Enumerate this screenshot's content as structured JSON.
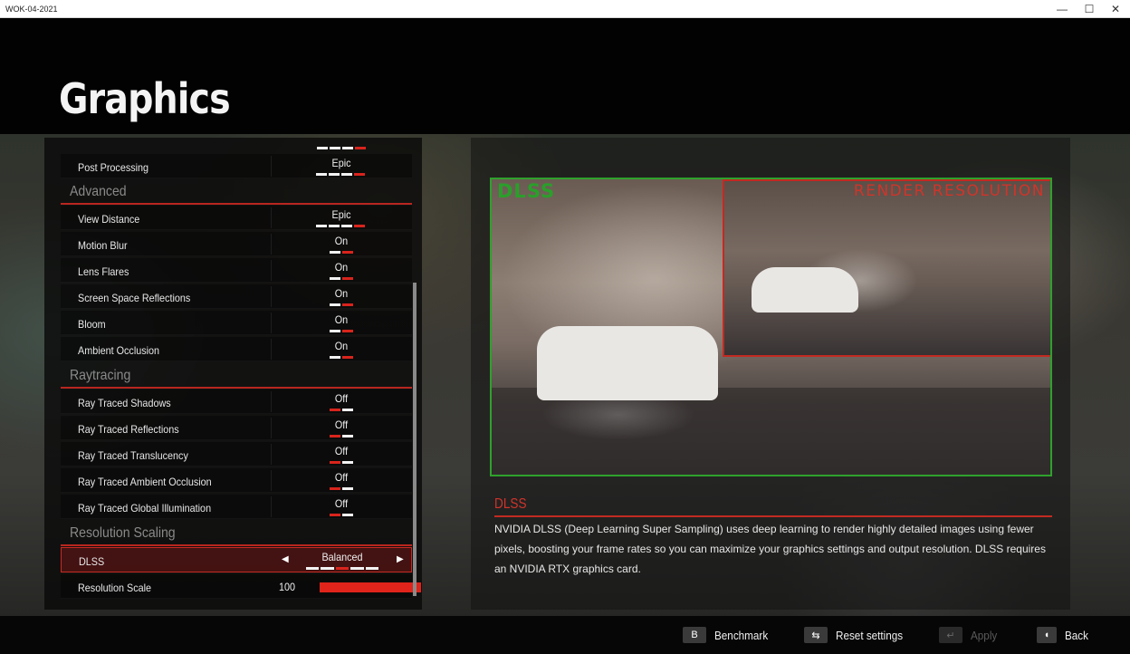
{
  "window": {
    "title": "WOK-04-2021",
    "minimize": "—",
    "maximize": "☐",
    "close": "✕"
  },
  "page": {
    "title": "Graphics"
  },
  "settings": {
    "rows": [
      {
        "label": "Post Processing",
        "value": "Epic",
        "pips": [
          "w",
          "w",
          "w",
          "r"
        ]
      },
      {
        "label": "View Distance",
        "value": "Epic",
        "pips": [
          "w",
          "w",
          "w",
          "r"
        ]
      },
      {
        "label": "Motion Blur",
        "value": "On",
        "pips": [
          "w",
          "r"
        ]
      },
      {
        "label": "Lens Flares",
        "value": "On",
        "pips": [
          "w",
          "r"
        ]
      },
      {
        "label": "Screen Space Reflections",
        "value": "On",
        "pips": [
          "w",
          "r"
        ]
      },
      {
        "label": "Bloom",
        "value": "On",
        "pips": [
          "w",
          "r"
        ]
      },
      {
        "label": "Ambient Occlusion",
        "value": "On",
        "pips": [
          "w",
          "r"
        ]
      },
      {
        "label": "Ray Traced Shadows",
        "value": "Off",
        "pips": [
          "r",
          "w"
        ]
      },
      {
        "label": "Ray Traced Reflections",
        "value": "Off",
        "pips": [
          "r",
          "w"
        ]
      },
      {
        "label": "Ray Traced Translucency",
        "value": "Off",
        "pips": [
          "r",
          "w"
        ]
      },
      {
        "label": "Ray Traced Ambient Occlusion",
        "value": "Off",
        "pips": [
          "r",
          "w"
        ]
      },
      {
        "label": "Ray Traced Global Illumination",
        "value": "Off",
        "pips": [
          "r",
          "w"
        ]
      }
    ],
    "sections": {
      "advanced": "Advanced",
      "raytracing": "Raytracing",
      "resolution_scaling": "Resolution Scaling"
    },
    "dlss": {
      "label": "DLSS",
      "value": "Balanced",
      "left_arrow": "◀",
      "right_arrow": "▶",
      "pips": [
        "w",
        "w",
        "r",
        "w",
        "w"
      ]
    },
    "resolution_scale": {
      "label": "Resolution Scale",
      "value": "100",
      "fraction": 1.0
    }
  },
  "preview": {
    "dlss_tag": "DLSS",
    "render_tag": "RENDER RESOLUTION",
    "title": "DLSS",
    "description": "NVIDIA DLSS (Deep Learning Super Sampling) uses deep learning to render highly detailed images using fewer pixels, boosting your frame rates so you can maximize your graphics settings and output resolution. DLSS requires an NVIDIA RTX graphics card."
  },
  "bottom_bar": {
    "benchmark": {
      "key": "B",
      "label": "Benchmark"
    },
    "reset": {
      "key": "⇆",
      "label": "Reset settings"
    },
    "apply": {
      "key": "↵",
      "label": "Apply"
    },
    "back": {
      "key": "◖",
      "label": "Back"
    }
  },
  "colors": {
    "accent_red": "#d8241c",
    "dlss_green": "#2fa12c",
    "section_gray": "#8a8a8a"
  }
}
